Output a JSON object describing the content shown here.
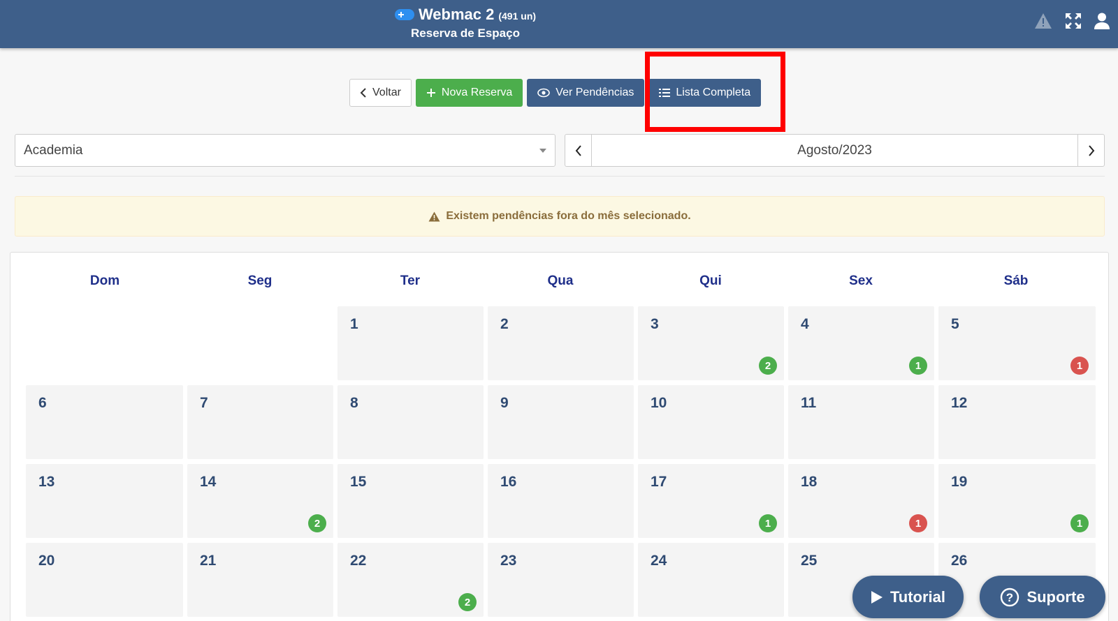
{
  "header": {
    "app_name": "Webmac 2",
    "units": "(491 un)",
    "subtitle": "Reserva de Espaço",
    "icons": [
      "warning-icon",
      "expand-icon",
      "user-icon"
    ]
  },
  "toolbar": {
    "back_label": "Voltar",
    "new_label": "Nova Reserva",
    "pending_label": "Ver Pendências",
    "list_label": "Lista Completa"
  },
  "filters": {
    "space_selected": "Academia",
    "month_label": "Agosto/2023"
  },
  "alert": {
    "message": "Existem pendências fora do mês selecionado."
  },
  "calendar": {
    "weekdays": [
      "Dom",
      "Seg",
      "Ter",
      "Qua",
      "Qui",
      "Sex",
      "Sáb"
    ],
    "days": [
      {
        "n": "1",
        "col": 2,
        "row": 0
      },
      {
        "n": "2",
        "col": 3,
        "row": 0
      },
      {
        "n": "3",
        "col": 4,
        "row": 0,
        "badge": "2",
        "color": "#4cae4c"
      },
      {
        "n": "4",
        "col": 5,
        "row": 0,
        "badge": "1",
        "color": "#4cae4c"
      },
      {
        "n": "5",
        "col": 6,
        "row": 0,
        "badge": "1",
        "color": "#d9534f"
      },
      {
        "n": "6",
        "col": 0,
        "row": 1
      },
      {
        "n": "7",
        "col": 1,
        "row": 1
      },
      {
        "n": "8",
        "col": 2,
        "row": 1
      },
      {
        "n": "9",
        "col": 3,
        "row": 1
      },
      {
        "n": "10",
        "col": 4,
        "row": 1
      },
      {
        "n": "11",
        "col": 5,
        "row": 1
      },
      {
        "n": "12",
        "col": 6,
        "row": 1
      },
      {
        "n": "13",
        "col": 0,
        "row": 2
      },
      {
        "n": "14",
        "col": 1,
        "row": 2,
        "badge": "2",
        "color": "#4cae4c"
      },
      {
        "n": "15",
        "col": 2,
        "row": 2
      },
      {
        "n": "16",
        "col": 3,
        "row": 2
      },
      {
        "n": "17",
        "col": 4,
        "row": 2,
        "badge": "1",
        "color": "#4cae4c"
      },
      {
        "n": "18",
        "col": 5,
        "row": 2,
        "badge": "1",
        "color": "#d9534f"
      },
      {
        "n": "19",
        "col": 6,
        "row": 2,
        "badge": "1",
        "color": "#4cae4c"
      },
      {
        "n": "20",
        "col": 0,
        "row": 3
      },
      {
        "n": "21",
        "col": 1,
        "row": 3
      },
      {
        "n": "22",
        "col": 2,
        "row": 3,
        "badge": "2",
        "color": "#4cae4c"
      },
      {
        "n": "23",
        "col": 3,
        "row": 3
      },
      {
        "n": "24",
        "col": 4,
        "row": 3
      },
      {
        "n": "25",
        "col": 5,
        "row": 3
      },
      {
        "n": "26",
        "col": 6,
        "row": 3
      }
    ]
  },
  "floating": {
    "tutorial_label": "Tutorial",
    "support_label": "Suporte"
  },
  "colors": {
    "primary": "#3e5f8a",
    "success": "#4cae4c",
    "danger": "#d9534f",
    "highlight": "#ff0000"
  }
}
